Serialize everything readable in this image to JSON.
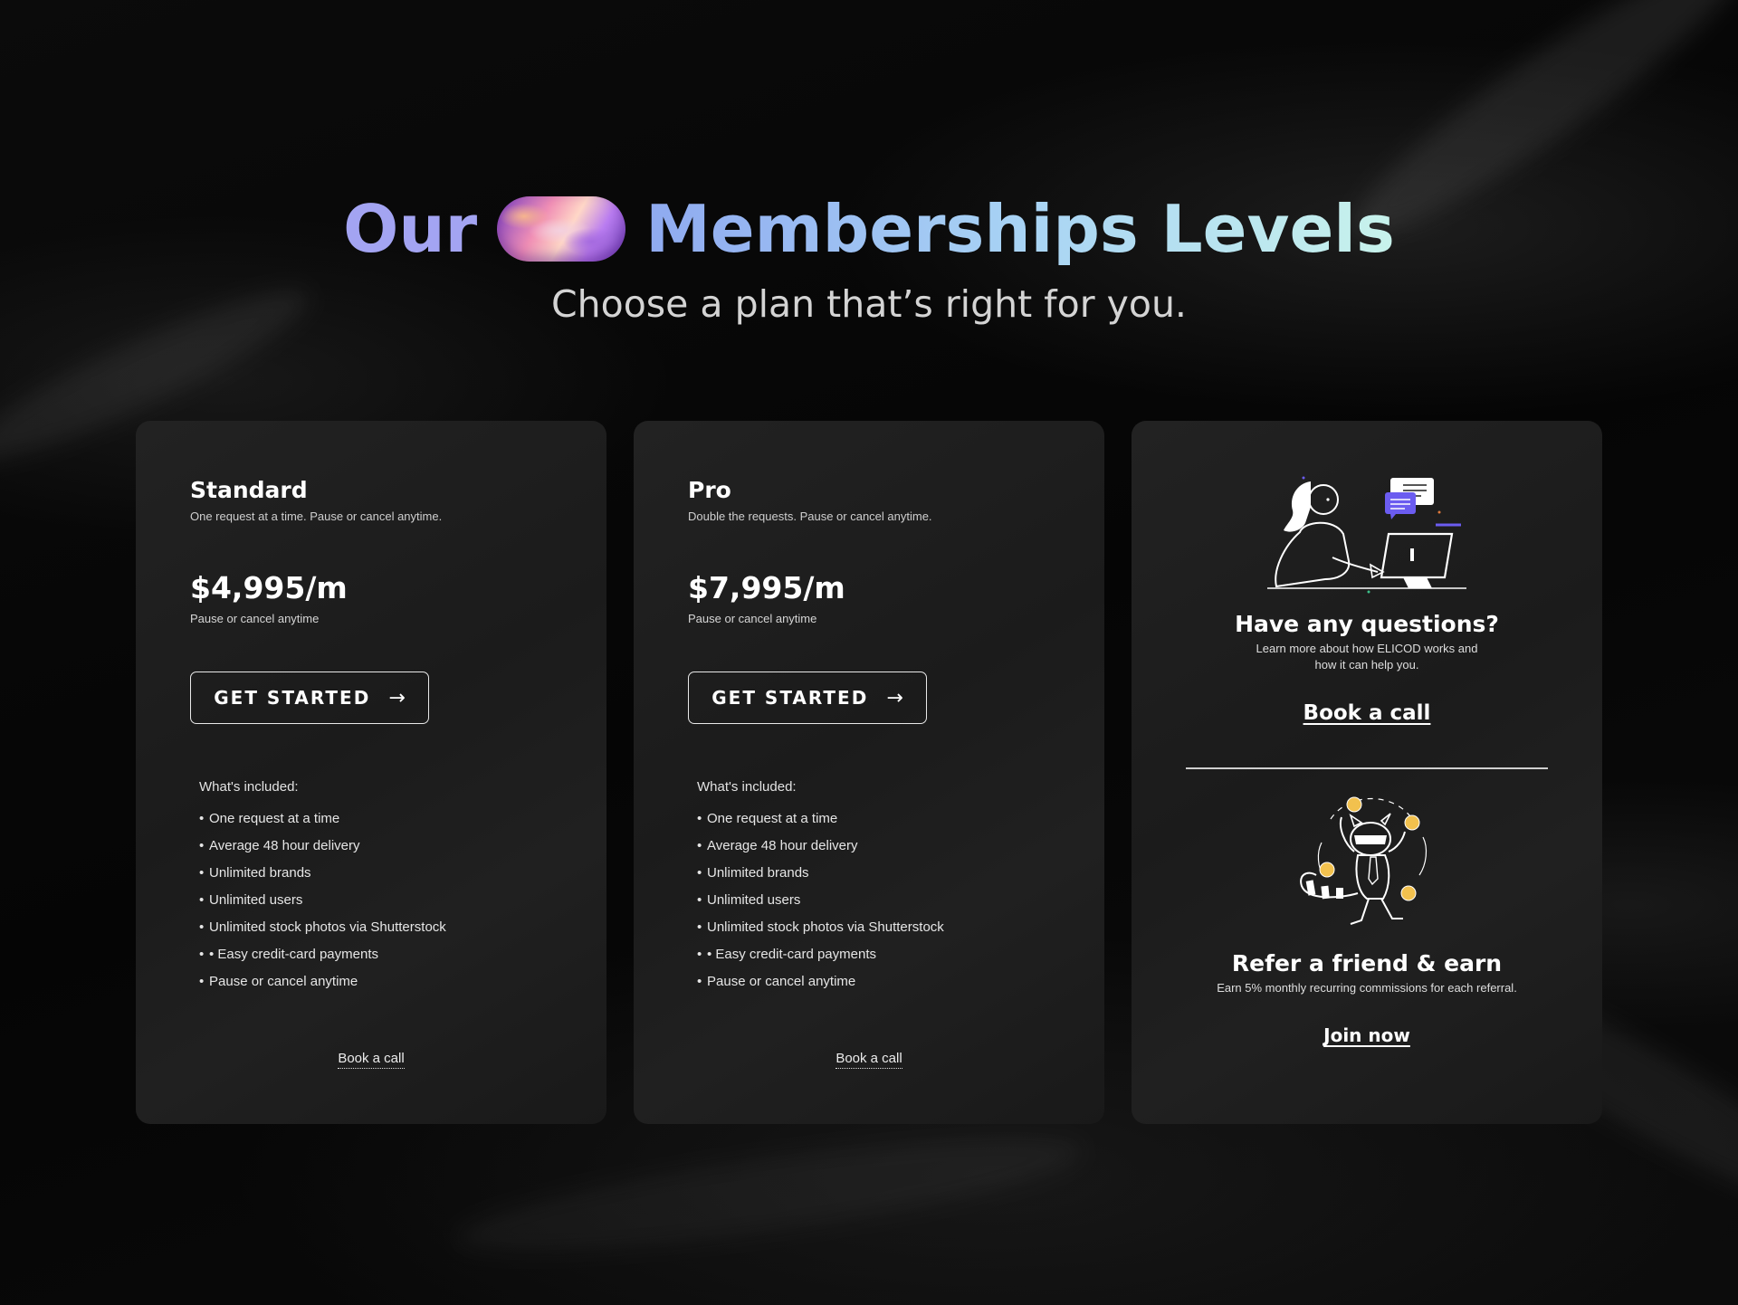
{
  "hero": {
    "title_part1": "Our",
    "title_part2": "Memberships Levels",
    "subtitle": "Choose a plan that’s right for you."
  },
  "plans": [
    {
      "name": "Standard",
      "description": "One request at a time. Pause or cancel anytime.",
      "price": "$4,995/m",
      "price_note": "Pause or cancel anytime",
      "cta_label": "GET STARTED",
      "included_heading": "What's included:",
      "features": [
        "One request at a time",
        "Average 48 hour delivery",
        "Unlimited brands",
        "Unlimited users",
        "Unlimited stock photos via Shutterstock",
        "• Easy credit-card payments",
        "Pause or cancel anytime"
      ],
      "book_call_label": "Book a call"
    },
    {
      "name": "Pro",
      "description": "Double the requests. Pause or cancel anytime.",
      "price": "$7,995/m",
      "price_note": "Pause or cancel anytime",
      "cta_label": "GET STARTED",
      "included_heading": "What's included:",
      "features": [
        "One request at a time",
        "Average 48 hour delivery",
        "Unlimited brands",
        "Unlimited users",
        "Unlimited stock photos via Shutterstock",
        "• Easy credit-card payments",
        "Pause or cancel anytime"
      ],
      "book_call_label": "Book a call"
    }
  ],
  "help_card": {
    "questions_title": "Have any questions?",
    "questions_text": "Learn more about how ELICOD works and how it can help you.",
    "questions_link": "Book a call",
    "refer_title": "Refer a friend & earn",
    "refer_text": "Earn 5% monthly recurring commissions for each referral.",
    "refer_link": "Join now"
  },
  "icons": {
    "cta_arrow": "arrow-right-icon",
    "questions_illustration": "woman-at-computer-icon",
    "refer_illustration": "raccoon-juggling-coins-icon"
  },
  "colors": {
    "background": "#070707",
    "card": "#1e1e1e",
    "title_our": "#a3a4f2",
    "title_gradient_start": "#8faaf0",
    "title_gradient_end": "#c8f3ec",
    "accent_purple": "#6b5cf0",
    "coin": "#f2c14e"
  }
}
